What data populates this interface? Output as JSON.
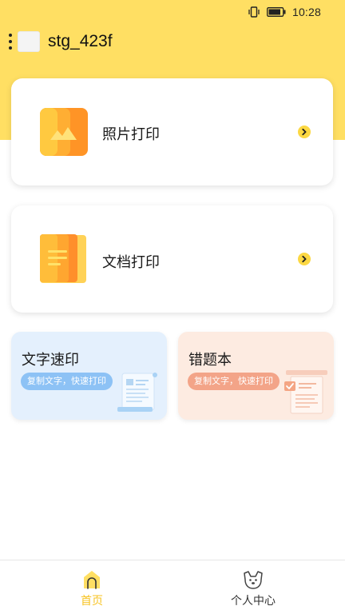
{
  "status_bar": {
    "time": "10:28",
    "icons": [
      "vibrate-icon",
      "battery-icon"
    ]
  },
  "header": {
    "menu_icon": "more-vert-icon",
    "device_name": "stg_423f"
  },
  "cards": {
    "photo": {
      "title": "照片打印",
      "icon": "photo-print-icon",
      "arrow": "chevron-right-icon"
    },
    "document": {
      "title": "文档打印",
      "icon": "document-print-icon",
      "arrow": "chevron-right-icon"
    }
  },
  "tiles": {
    "quick_text": {
      "title": "文字速印",
      "subtitle": "复制文字，快速打印",
      "icon": "text-page-icon"
    },
    "mistake_book": {
      "title": "错题本",
      "subtitle": "复制文字，快速打印",
      "icon": "checklist-page-icon"
    }
  },
  "bottom_nav": {
    "items": [
      {
        "label": "首页",
        "icon": "home-icon",
        "active": true
      },
      {
        "label": "个人中心",
        "icon": "profile-dog-icon",
        "active": false
      }
    ]
  },
  "colors": {
    "brand_yellow": "#FFDF63",
    "active_tab": "#F7C322",
    "photo_orange": "#FF9426",
    "doc_orange": "#FFB52E",
    "ocr_tile_bg": "#E4F0FD",
    "mistake_tile_bg": "#FDEBE1"
  }
}
